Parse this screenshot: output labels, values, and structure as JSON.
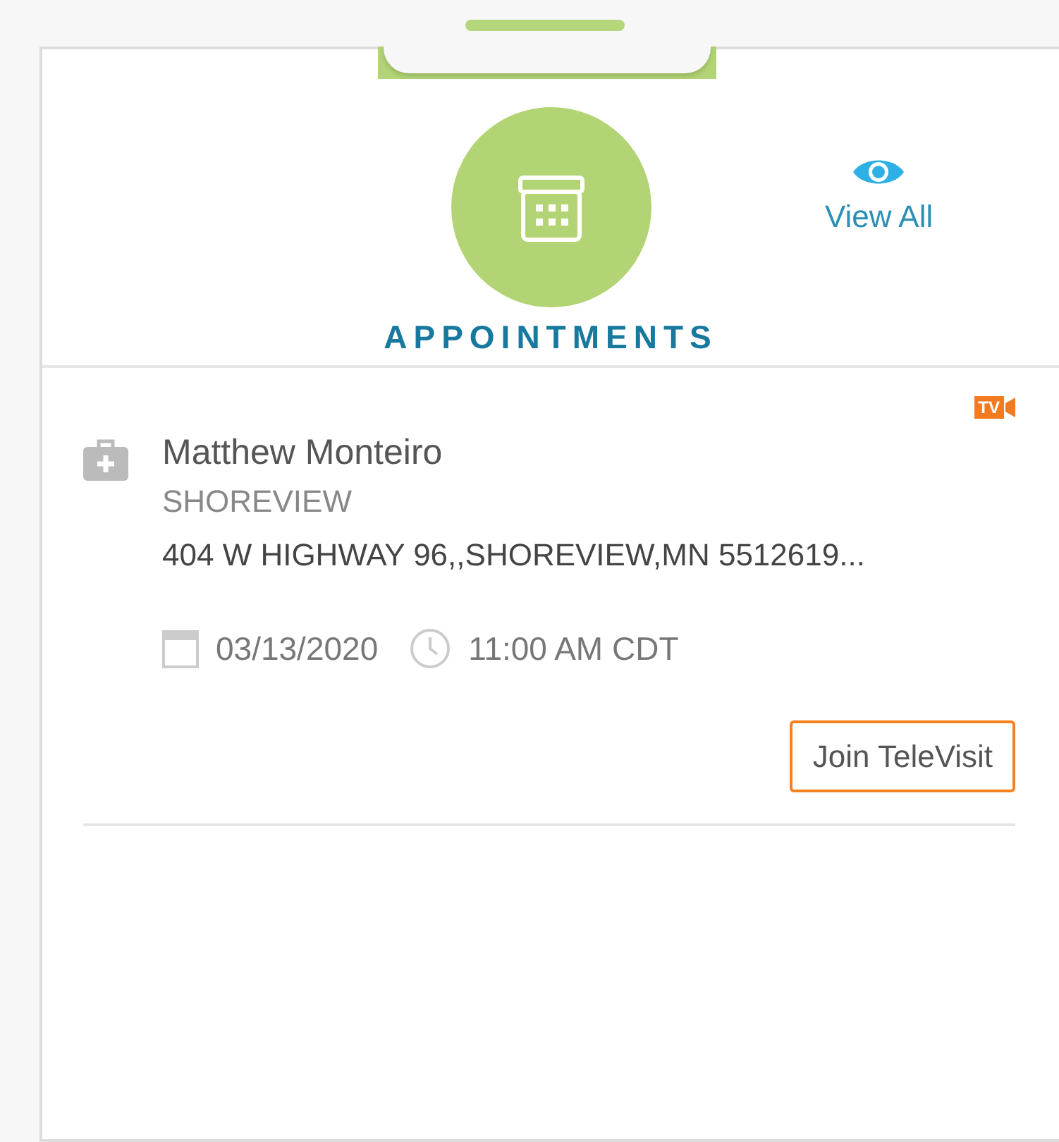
{
  "header": {
    "title": "APPOINTMENTS",
    "view_all": "View All"
  },
  "appointments": [
    {
      "badge": "TV",
      "provider": "Matthew Monteiro",
      "location": "SHOREVIEW",
      "address": "404 W HIGHWAY 96,,SHOREVIEW,MN 5512619...",
      "date": "03/13/2020",
      "time": "11:00 AM CDT",
      "action": "Join TeleVisit"
    }
  ]
}
